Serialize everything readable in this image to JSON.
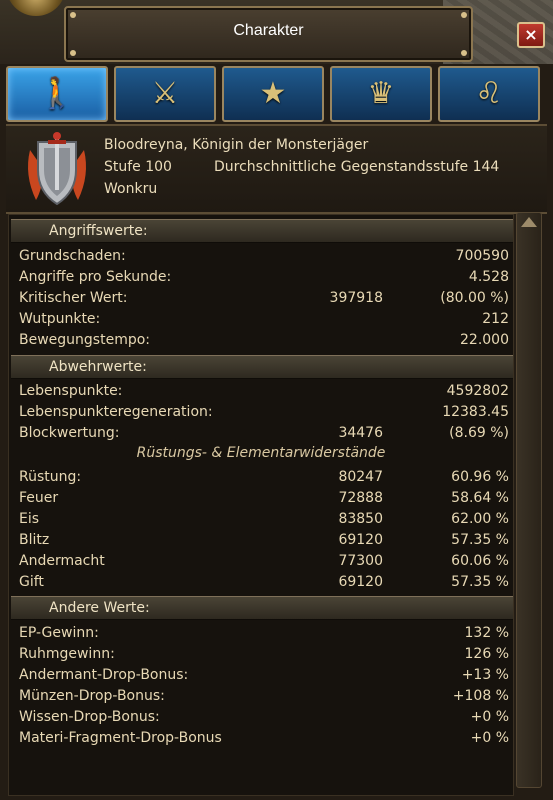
{
  "window": {
    "title": "Charakter",
    "close_label": "×"
  },
  "tabs": [
    {
      "name": "character",
      "icon": "figure-icon",
      "glyph": "🚶",
      "active": true
    },
    {
      "name": "combat",
      "icon": "crossed-swords-icon",
      "glyph": "⚔",
      "active": false
    },
    {
      "name": "achievements",
      "icon": "medal-star-icon",
      "glyph": "★",
      "active": false
    },
    {
      "name": "titles",
      "icon": "crown-icon",
      "glyph": "♛",
      "active": false
    },
    {
      "name": "companions",
      "icon": "lion-head-icon",
      "glyph": "♌",
      "active": false
    }
  ],
  "header": {
    "name_line": "Bloodreyna, Königin der Monsterjäger",
    "level": "Stufe 100",
    "item_level": "Durchschnittliche Gegenstandsstufe 144",
    "guild": "Wonkru"
  },
  "sections": {
    "attack": {
      "title": "Angriffswerte:",
      "rows": [
        {
          "label": "Grundschaden:",
          "mid": "",
          "value": "700590"
        },
        {
          "label": "Angriffe pro Sekunde:",
          "mid": "",
          "value": "4.528"
        },
        {
          "label": "Kritischer Wert:",
          "mid": "397918",
          "value": "(80.00 %)"
        },
        {
          "label": "Wutpunkte:",
          "mid": "",
          "value": "212"
        },
        {
          "label": "Bewegungstempo:",
          "mid": "",
          "value": "22.000"
        }
      ]
    },
    "defense": {
      "title": "Abwehrwerte:",
      "rows": [
        {
          "label": "Lebenspunkte:",
          "mid": "",
          "value": "4592802"
        },
        {
          "label": "Lebenspunkteregeneration:",
          "mid": "",
          "value": "12383.45"
        },
        {
          "label": "Blockwertung:",
          "mid": "34476",
          "value": "(8.69 %)"
        }
      ],
      "resist_title": "Rüstungs- & Elementarwiderstände",
      "resists": [
        {
          "label": "Rüstung:",
          "mid": "80247",
          "value": "60.96 %"
        },
        {
          "label": "Feuer",
          "mid": "72888",
          "value": "58.64 %"
        },
        {
          "label": "Eis",
          "mid": "83850",
          "value": "62.00 %"
        },
        {
          "label": "Blitz",
          "mid": "69120",
          "value": "57.35 %"
        },
        {
          "label": "Andermacht",
          "mid": "77300",
          "value": "60.06 %"
        },
        {
          "label": "Gift",
          "mid": "69120",
          "value": "57.35 %"
        }
      ]
    },
    "other": {
      "title": "Andere Werte:",
      "rows": [
        {
          "label": "EP-Gewinn:",
          "mid": "",
          "value": "132 %"
        },
        {
          "label": "Ruhmgewinn:",
          "mid": "",
          "value": "126 %"
        },
        {
          "label": "Andermant-Drop-Bonus:",
          "mid": "",
          "value": "+13 %"
        },
        {
          "label": "Münzen-Drop-Bonus:",
          "mid": "",
          "value": "+108 %"
        },
        {
          "label": "Wissen-Drop-Bonus:",
          "mid": "",
          "value": "+0 %"
        },
        {
          "label": "Materi-Fragment-Drop-Bonus",
          "mid": "",
          "value": "+0 %"
        }
      ]
    }
  },
  "colors": {
    "accent": "#3aa3e8",
    "close": "#c03a2e",
    "text": "#e8d9b5",
    "frame": "#9a8660"
  }
}
